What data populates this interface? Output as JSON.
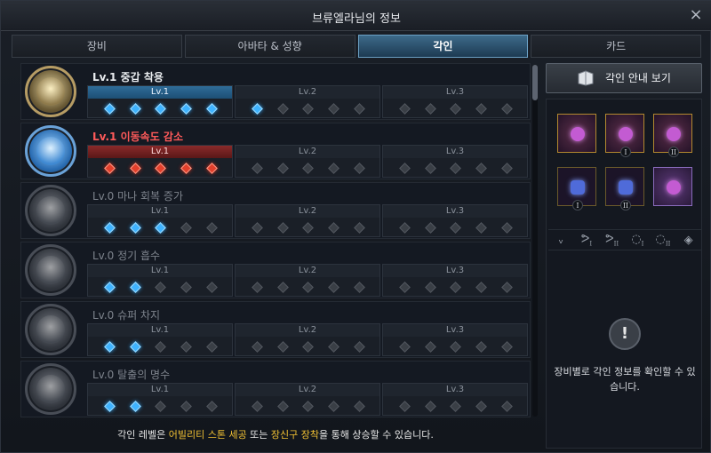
{
  "window": {
    "title": "브류엘라님의 정보",
    "close_icon": "×"
  },
  "tabs": [
    {
      "label": "장비",
      "active": false
    },
    {
      "label": "아바타 & 성향",
      "active": false
    },
    {
      "label": "각인",
      "active": true
    },
    {
      "label": "카드",
      "active": false
    }
  ],
  "engravings": [
    {
      "name": "Lv.1 중갑 착용",
      "style": "normal",
      "icon": "armor-icon",
      "levels": [
        "Lv.1",
        "Lv.2",
        "Lv.3"
      ],
      "active_level": 0,
      "active_color": "blue",
      "filled": 6
    },
    {
      "name": "Lv.1 이동속도 감소",
      "style": "red",
      "icon": "speed-down-icon",
      "levels": [
        "Lv.1",
        "Lv.2",
        "Lv.3"
      ],
      "active_level": 0,
      "active_color": "red",
      "filled": 5
    },
    {
      "name": "Lv.0 마나 회복 증가",
      "style": "grey",
      "icon": "mana-icon",
      "levels": [
        "Lv.1",
        "Lv.2",
        "Lv.3"
      ],
      "active_level": -1,
      "active_color": "blue",
      "filled": 3
    },
    {
      "name": "Lv.0 정기 흡수",
      "style": "grey",
      "icon": "spirit-icon",
      "levels": [
        "Lv.1",
        "Lv.2",
        "Lv.3"
      ],
      "active_level": -1,
      "active_color": "blue",
      "filled": 2
    },
    {
      "name": "Lv.0 슈퍼 차지",
      "style": "grey",
      "icon": "charge-icon",
      "levels": [
        "Lv.1",
        "Lv.2",
        "Lv.3"
      ],
      "active_level": -1,
      "active_color": "blue",
      "filled": 2
    },
    {
      "name": "Lv.0 탈출의 명수",
      "style": "grey",
      "icon": "escape-icon",
      "levels": [
        "Lv.1",
        "Lv.2",
        "Lv.3"
      ],
      "active_level": -1,
      "active_color": "blue",
      "filled": 2
    }
  ],
  "footer": {
    "prefix": "각인 레벨은 ",
    "hl1": "어빌리티 스톤 세공",
    "mid": " 또는 ",
    "hl2": "장신구 장착",
    "suffix": "을 통해 상승할 수 있습니다."
  },
  "right": {
    "guide_label": "각인 안내 보기",
    "accessories": [
      {
        "icon": "necklace-icon",
        "numeral": ""
      },
      {
        "icon": "earring-icon",
        "numeral": "I"
      },
      {
        "icon": "earring-icon",
        "numeral": "II"
      },
      {
        "icon": "ring-icon",
        "numeral": "I"
      },
      {
        "icon": "ring-icon",
        "numeral": "II"
      },
      {
        "icon": "ability-stone-icon",
        "numeral": ""
      }
    ],
    "slot_filters": [
      {
        "glyph": "ᵥ",
        "sub": ""
      },
      {
        "glyph": "ᕗ",
        "sub": "I"
      },
      {
        "glyph": "ᕗ",
        "sub": "II"
      },
      {
        "glyph": "◌",
        "sub": "I"
      },
      {
        "glyph": "◌",
        "sub": "II"
      },
      {
        "glyph": "◈",
        "sub": ""
      }
    ],
    "info_text": "장비별로 각인 정보를 확인할 수 있습니다."
  },
  "colors": {
    "accent_blue": "#3fb3ff",
    "accent_red": "#e2402c",
    "highlight": "#f0c033"
  }
}
